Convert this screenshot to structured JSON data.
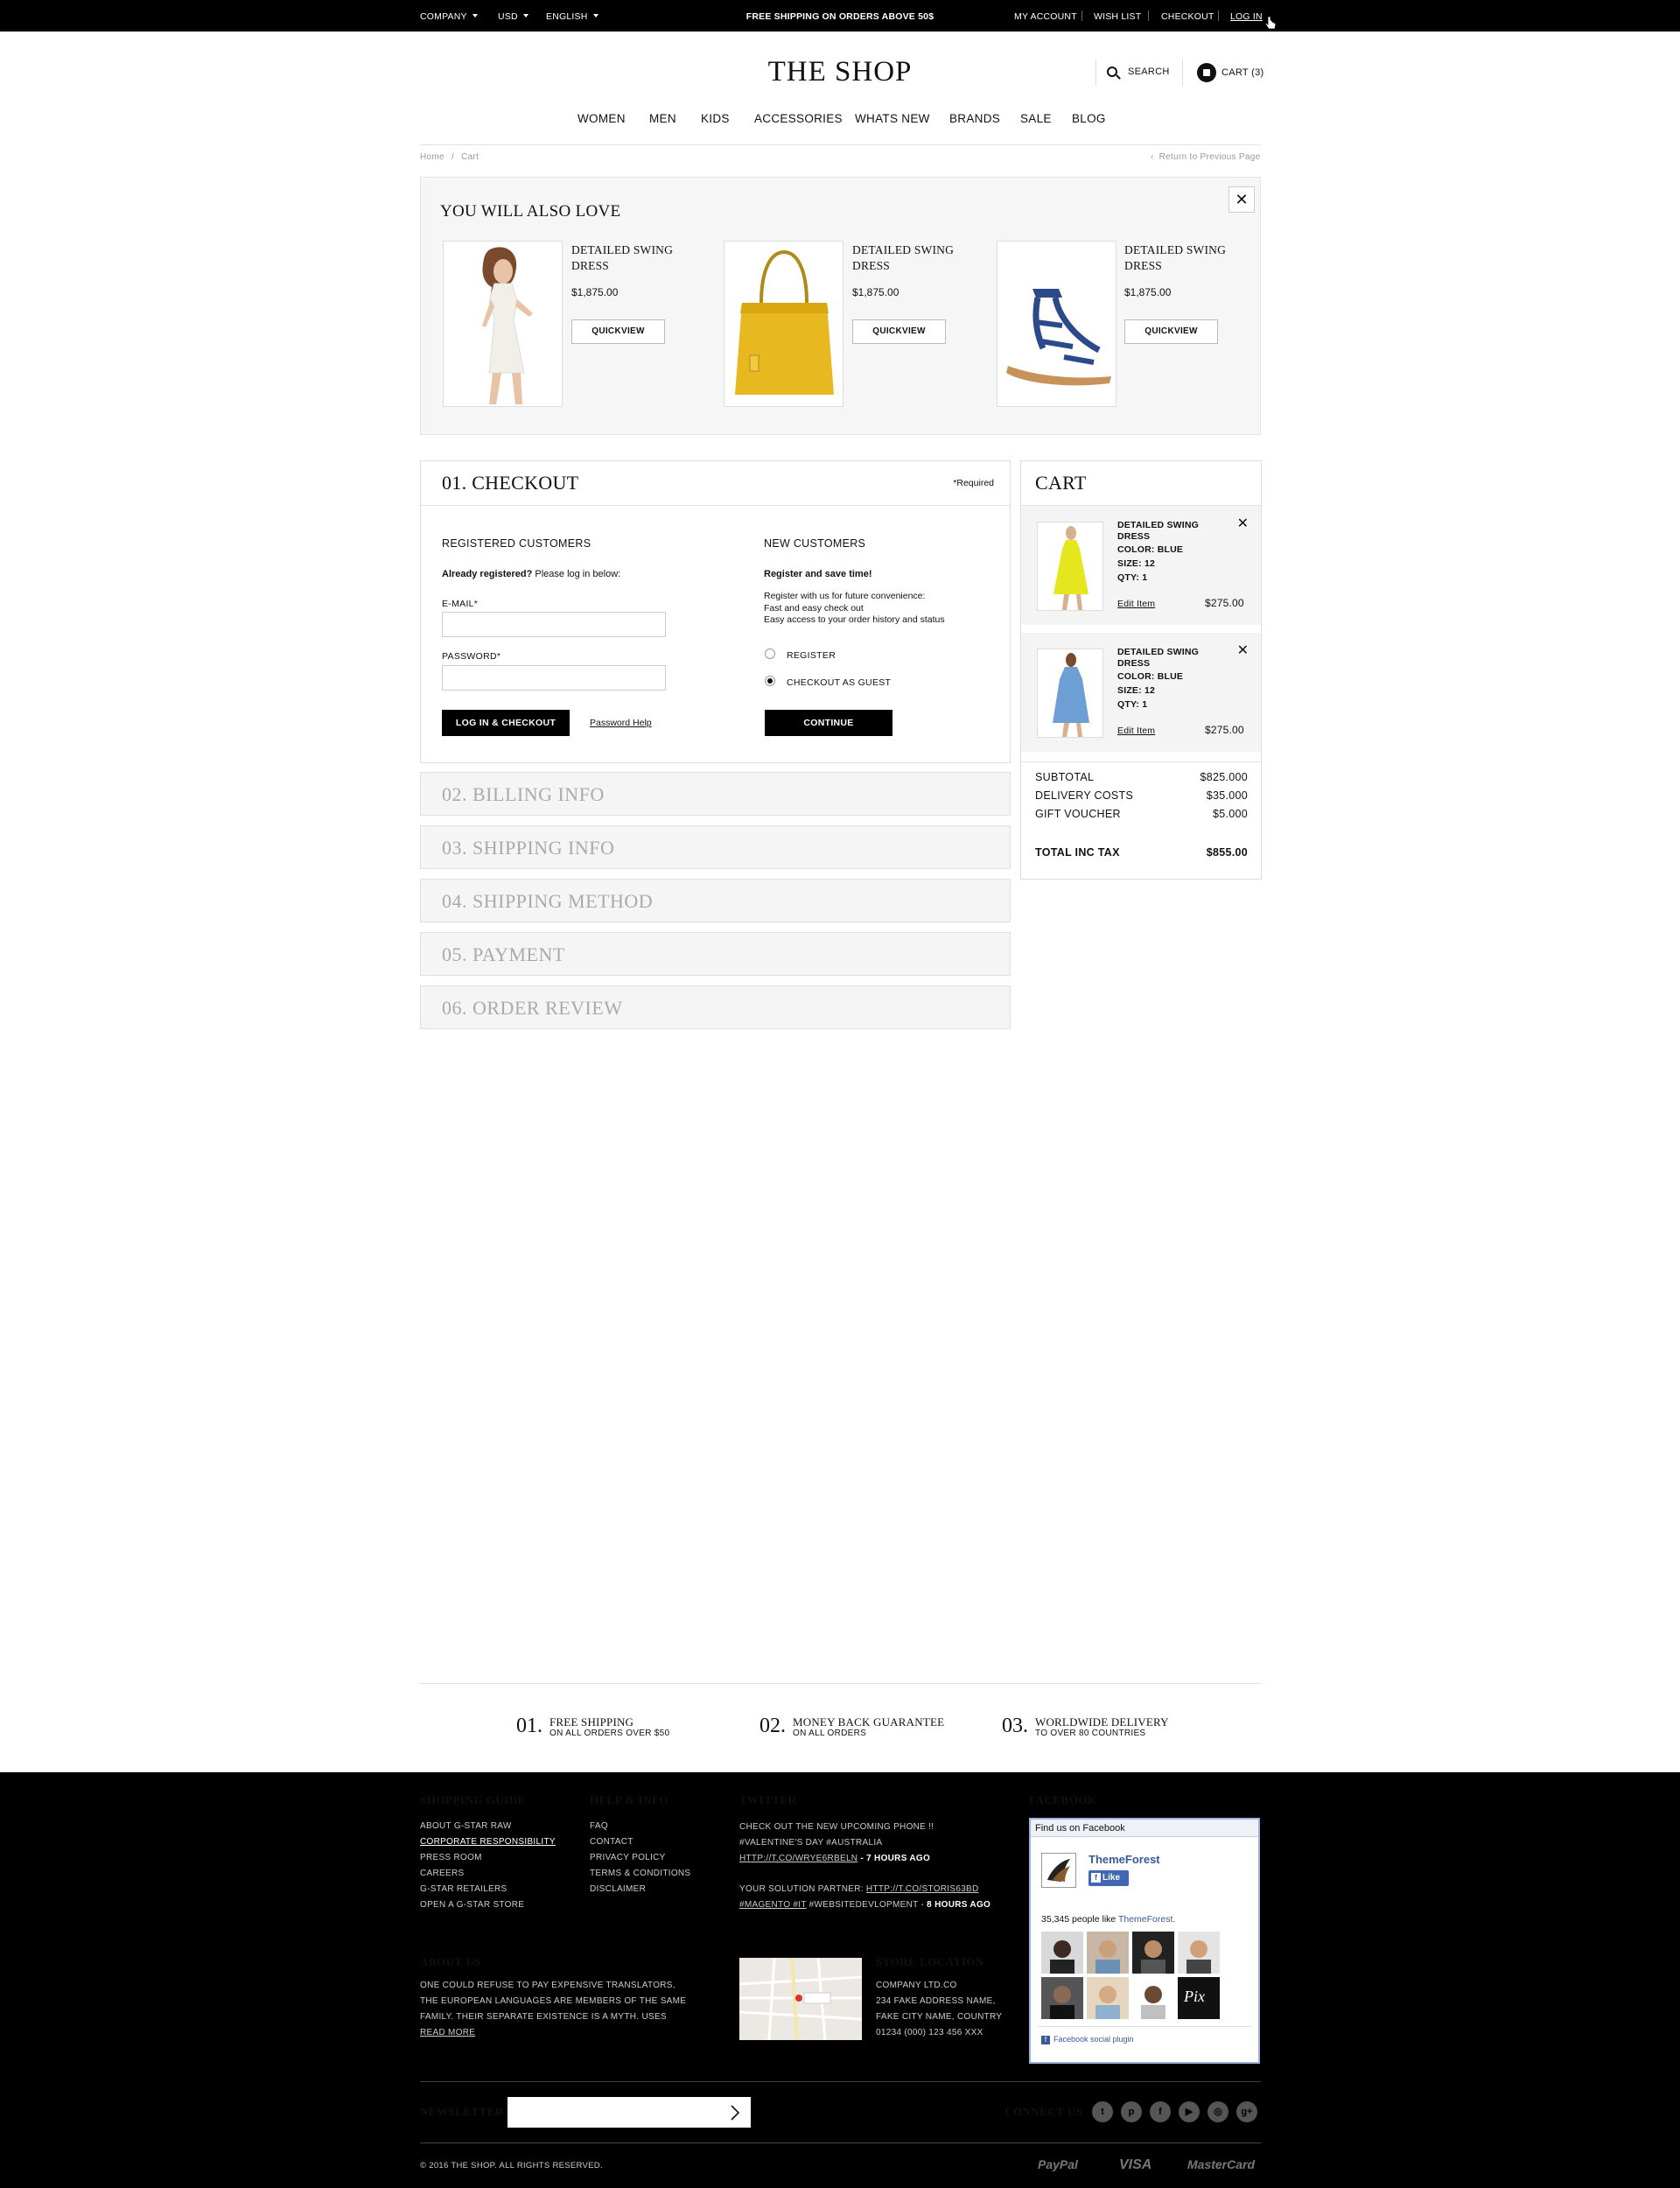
{
  "topbar": {
    "company": "COMPANY",
    "currency": "USD",
    "language": "ENGLISH",
    "promo": "FREE SHIPPING ON ORDERS ABOVE 50$",
    "my_account": "MY ACCOUNT",
    "wish_list": "WISH LIST",
    "checkout": "CHECKOUT",
    "login": "LOG IN"
  },
  "header": {
    "logo": "THE SHOP",
    "search": "SEARCH",
    "cart": "CART (3)"
  },
  "nav": [
    "WOMEN",
    "MEN",
    "KIDS",
    "ACCESSORIES",
    "WHATS NEW",
    "BRANDS",
    "SALE",
    "BLOG"
  ],
  "breadcrumb": {
    "home": "Home",
    "sep": "/",
    "current": "Cart",
    "return": "Return to Previous Page"
  },
  "also_love": {
    "title": "YOU WILL ALSO LOVE",
    "close": "✕",
    "products": [
      {
        "name": "DETAILED SWING DRESS",
        "price": "$1,875.00",
        "button": "QUICKVIEW"
      },
      {
        "name": "DETAILED SWING DRESS",
        "price": "$1,875.00",
        "button": "QUICKVIEW"
      },
      {
        "name": "DETAILED SWING DRESS",
        "price": "$1,875.00",
        "button": "QUICKVIEW"
      }
    ]
  },
  "checkout": {
    "title": "01. CHECKOUT",
    "required": "*Required",
    "registered": {
      "heading": "REGISTERED CUSTOMERS",
      "intro_bold": "Already registered?",
      "intro_rest": " Please log in below:",
      "email_label": "E-MAIL*",
      "email_value": "",
      "password_label": "PASSWORD*",
      "password_value": "",
      "login_button": "LOG IN & CHECKOUT",
      "help_link": "Password Help"
    },
    "new": {
      "heading": "NEW CUSTOMERS",
      "intro_bold": "Register and save time!",
      "line1": "Register with us for future convenience:",
      "line2": "Fast and easy check out",
      "line3": "Easy access to your order history and status",
      "opt_register": "REGISTER",
      "opt_guest": "CHECKOUT AS GUEST",
      "selected": "CHECKOUT AS GUEST",
      "continue_button": "CONTINUE"
    }
  },
  "steps": [
    "02. BILLING INFO",
    "03. SHIPPING INFO",
    "04. SHIPPING METHOD",
    "05. PAYMENT",
    "06. ORDER REVIEW"
  ],
  "cart": {
    "title": "CART",
    "items": [
      {
        "name_line1": "DETAILED SWING",
        "name_line2": "DRESS",
        "color": "COLOR: BLUE",
        "size": "SIZE: 12",
        "qty": "QTY: 1",
        "edit": "Edit Item",
        "price": "$275.00",
        "remove": "✕"
      },
      {
        "name_line1": "DETAILED SWING",
        "name_line2": "DRESS",
        "color": "COLOR: BLUE",
        "size": "SIZE: 12",
        "qty": "QTY: 1",
        "edit": "Edit Item",
        "price": "$275.00",
        "remove": "✕"
      }
    ],
    "subtotal_label": "SUBTOTAL",
    "subtotal": "$825.000",
    "delivery_label": "DELIVERY COSTS",
    "delivery": "$35.000",
    "voucher_label": "GIFT VOUCHER",
    "voucher": "$5.000",
    "total_label": "TOTAL INC TAX",
    "total": "$855.00"
  },
  "features": [
    {
      "num": "01.",
      "title": "FREE SHIPPING",
      "sub": "ON ALL ORDERS OVER $50"
    },
    {
      "num": "02.",
      "title": "MONEY BACK GUARANTEE",
      "sub": "ON ALL ORDERS"
    },
    {
      "num": "03.",
      "title": "WORLDWIDE DELIVERY",
      "sub": "TO OVER 80 COUNTRIES"
    }
  ],
  "footer": {
    "shopping_guide": {
      "title": "SHOPPING GUIDE",
      "links": [
        "ABOUT G-STAR RAW",
        "CORPORATE RESPONSIBILITY",
        "PRESS ROOM",
        "CAREERS",
        "G-STAR RETAILERS",
        "OPEN A G-STAR STORE"
      ]
    },
    "help": {
      "title": "HELP & INFO",
      "links": [
        "FAQ",
        "CONTACT",
        "PRIVACY POLICY",
        "TERMS & CONDITIONS",
        "DISCLAIMER"
      ]
    },
    "twitter": {
      "title": "TWITTER",
      "t1_text": "CHECK OUT THE NEW UPCOMING PHONE !! #VALENTINE'S DAY #AUSTRALIA ",
      "t1_link": "HTTP://T.CO/WRYE6RBELN",
      "t1_time": " - 7 HOURS AGO",
      "t2_text": "YOUR SOLUTION PARTNER: ",
      "t2_link": "HTTP://T.CO/STORIS63BD",
      "t2_tags": "#MAGENTO #IT",
      "t2_rest": " #WEBSITEDEVLOPMENT - ",
      "t2_time": "8 HOURS AGO"
    },
    "facebook": {
      "title": "FACEBOOK",
      "find": "Find us on Facebook",
      "page": "ThemeForest",
      "like": "Like",
      "count_text": "35,345 people like ",
      "count_page": "ThemeForest.",
      "plugin": "Facebook social plugin"
    },
    "about": {
      "title": "ABOUT US",
      "text": "ONE COULD REFUSE TO PAY EXPENSIVE TRANSLATORS, THE EUROPEAN LANGUAGES ARE MEMBERS OF THE SAME FAMILY. THEIR SEPARATE EXISTENCE IS A MYTH. USES ",
      "read_more": "READ MORE"
    },
    "store": {
      "title": "STORE LOCATION",
      "line1": "COMPANY LTD.CO",
      "line2": "234 FAKE ADDRESS NAME,",
      "line3": "FAKE CITY NAME, COUNTRY",
      "line4": "01234 (000) 123 456 XXX"
    },
    "newsletter_label": "NEWSLETTER",
    "newsletter_value": "",
    "connect": "CONNECT US",
    "social": [
      "twitter-icon",
      "pinterest-icon",
      "facebook-icon",
      "youtube-icon",
      "instagram-icon",
      "google-plus-icon"
    ],
    "social_glyphs": [
      "t",
      "p",
      "f",
      "▶",
      "◎",
      "g+"
    ],
    "copyright": "© 2016 THE SHOP. ALL RIGHTS RESERVED.",
    "payments": [
      "PayPal",
      "VISA",
      "MasterCard"
    ]
  }
}
